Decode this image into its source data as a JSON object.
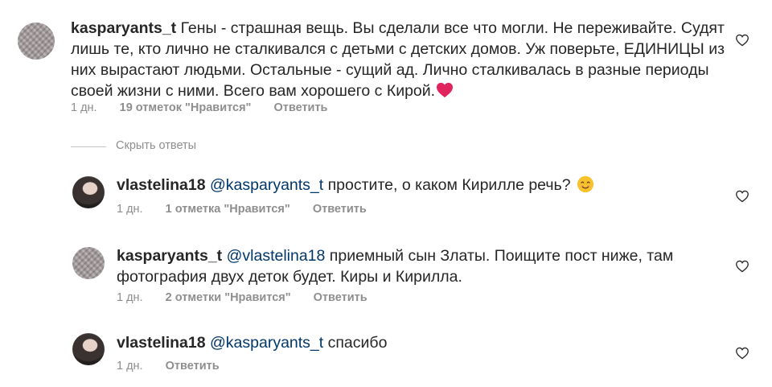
{
  "comments": [
    {
      "username": "kasparyants_t",
      "mention": "",
      "text": "Гены - страшная вещь. Вы сделали все что могли. Не переживайте. Судят лишь те, кто лично не сталкивался с детьми с детских домов. Уж поверьте, ЕДИНИЦЫ из них вырастают людьми. Остальные - сущий ад. Лично сталкивалась в разные периоды своей жизни с ними. Всего вам хорошего с Кирой.",
      "emoji": "red-heart",
      "time": "1 дн.",
      "likes": "19 отметок \"Нравится\"",
      "reply": "Ответить"
    },
    {
      "username": "vlastelina18",
      "mention": "@kasparyants_t",
      "text": "простите, о каком Кирилле речь?",
      "emoji": "smiling-face",
      "time": "1 дн.",
      "likes": "1 отметка \"Нравится\"",
      "reply": "Ответить"
    },
    {
      "username": "kasparyants_t",
      "mention": "@vlastelina18",
      "text": "приемный сын Златы. Поищите пост ниже, там фотография двух деток будет. Киры и Кирилла.",
      "emoji": "",
      "time": "1 дн.",
      "likes": "2 отметки \"Нравится\"",
      "reply": "Ответить"
    },
    {
      "username": "vlastelina18",
      "mention": "@kasparyants_t",
      "text": "спасибо",
      "emoji": "",
      "time": "1 дн.",
      "likes": "",
      "reply": "Ответить"
    }
  ],
  "replies_toggle": "Скрыть ответы",
  "colors": {
    "text": "#262626",
    "meta": "#8e8e8e",
    "mention": "#00376b",
    "heart": "#e0245e"
  },
  "icons": {
    "like": "heart-outline-icon"
  }
}
